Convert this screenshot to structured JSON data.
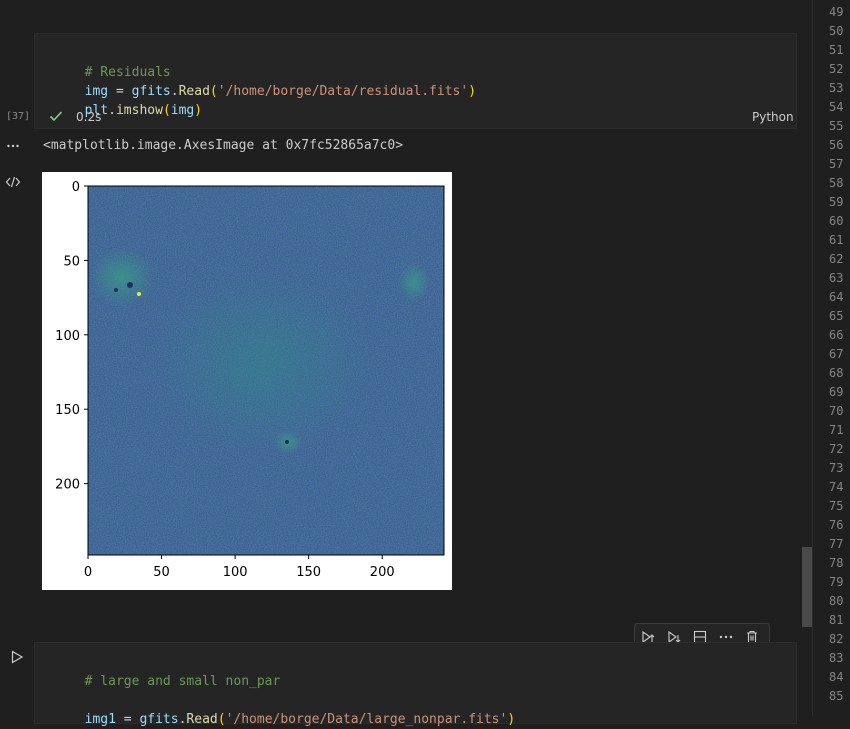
{
  "top_cell": {
    "comment": "# Residuals",
    "line2_var": "img",
    "line2_eq": " = ",
    "line2_mod": "gfits",
    "line2_dot": ".",
    "line2_fn": "Read",
    "line2_open": "(",
    "line2_str": "'/home/borge/Data/residual.fits'",
    "line2_close": ")",
    "line3_mod": "plt",
    "line3_dot": ".",
    "line3_fn": "imshow",
    "line3_open": "(",
    "line3_arg": "img",
    "line3_close": ")",
    "exec_count": "[37]",
    "exec_time": "0.2s",
    "language": "Python",
    "status_icon": "check-icon"
  },
  "output": {
    "repr_text": "<matplotlib.image.AxesImage at 0x7fc52865a7c0>",
    "more_icon": "ellipsis-icon",
    "code_icon": "code-icon"
  },
  "plot": {
    "y_ticks": [
      "0",
      "50",
      "100",
      "150",
      "200"
    ],
    "x_ticks": [
      "0",
      "50",
      "100",
      "150",
      "200"
    ],
    "image_fill": "#3b528b",
    "image_shape": [
      248,
      242
    ]
  },
  "chart_data": {
    "type": "heatmap",
    "title": "",
    "xlabel": "",
    "ylabel": "",
    "x_ticks": [
      0,
      50,
      100,
      150,
      200
    ],
    "y_ticks": [
      0,
      50,
      100,
      150,
      200
    ],
    "xlim": [
      0,
      242
    ],
    "ylim": [
      248,
      0
    ],
    "colormap": "viridis"
  },
  "cell_toolbar": {
    "items": [
      "run-above-icon",
      "run-below-icon",
      "split-cell-icon",
      "more-icon",
      "delete-icon"
    ]
  },
  "bottom_cell": {
    "comment": "# large and small non_par",
    "line2_var": "img1",
    "line2_eq": " = ",
    "line2_mod": "gfits",
    "line2_dot": ".",
    "line2_fn": "Read",
    "line2_open": "(",
    "line2_str": "'/home/borge/Data/large_nonpar.fits'",
    "line2_close": ")",
    "run_icon": "play-icon"
  },
  "gutter": {
    "numbers": [
      "49",
      "50",
      "51",
      "52",
      "53",
      "54",
      "55",
      "56",
      "57",
      "58",
      "59",
      "60",
      "61",
      "62",
      "63",
      "64",
      "65",
      "66",
      "67",
      "68",
      "69",
      "70",
      "71",
      "72",
      "73",
      "74",
      "75",
      "76",
      "77",
      "78",
      "79",
      "80",
      "81",
      "82",
      "83",
      "84",
      "85"
    ]
  },
  "colors": {
    "editor_bg": "#1f1f1f",
    "cell_bg": "#252526",
    "success": "#89d185",
    "comment": "#6a9955",
    "string": "#ce9178"
  }
}
